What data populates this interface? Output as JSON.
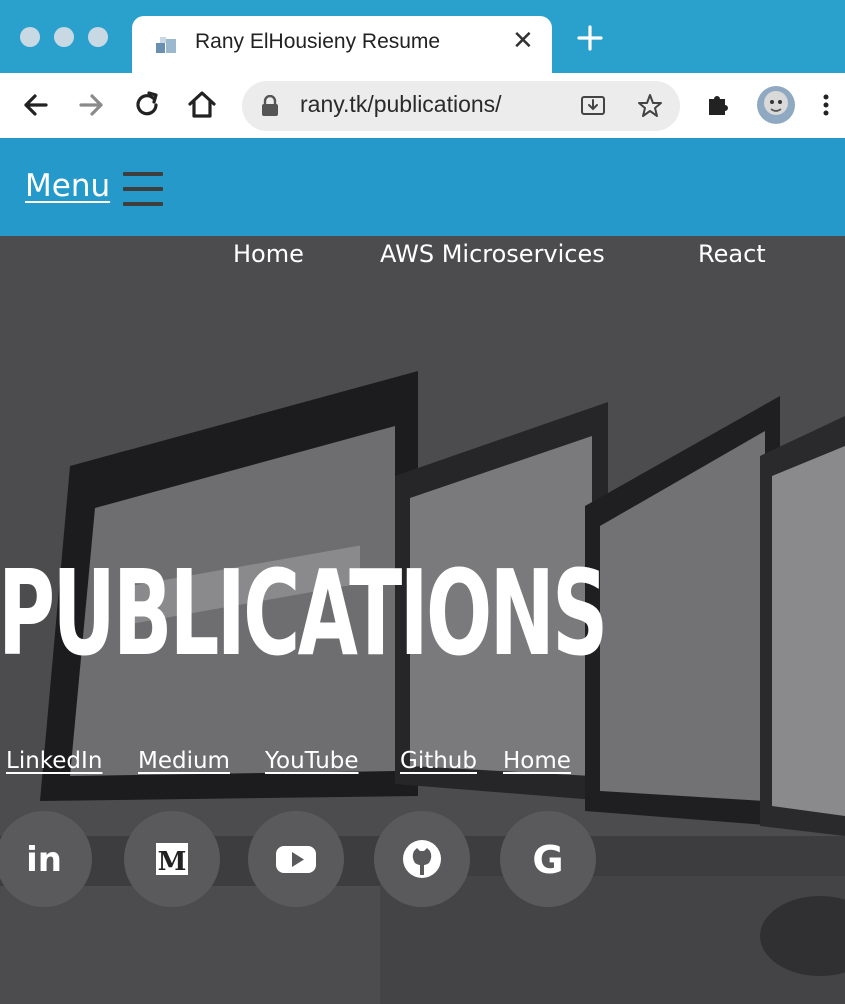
{
  "browser": {
    "tab_title": "Rany ElHousieny Resume",
    "tab_close": "✕",
    "url": "rany.tk/publications/",
    "icons": [
      "back-icon",
      "forward-icon",
      "reload-icon",
      "home-icon",
      "lock-icon",
      "install-icon",
      "star-icon",
      "extensions-icon",
      "profile-avatar",
      "more-icon",
      "new-tab-icon"
    ]
  },
  "header": {
    "menu_label": "Menu",
    "brand_color": "#2699cb"
  },
  "nav": {
    "items": [
      "Home",
      "AWS Microservices",
      "React"
    ]
  },
  "hero": {
    "title": "PUBLICATIONS",
    "links": [
      "LinkedIn",
      "Medium",
      "YouTube",
      "Github",
      "Home"
    ],
    "social_icons": [
      "linkedin-icon",
      "medium-icon",
      "youtube-icon",
      "github-icon",
      "google-icon"
    ],
    "social_labels": {
      "linkedin": "in",
      "medium": "M",
      "google": "G"
    }
  }
}
